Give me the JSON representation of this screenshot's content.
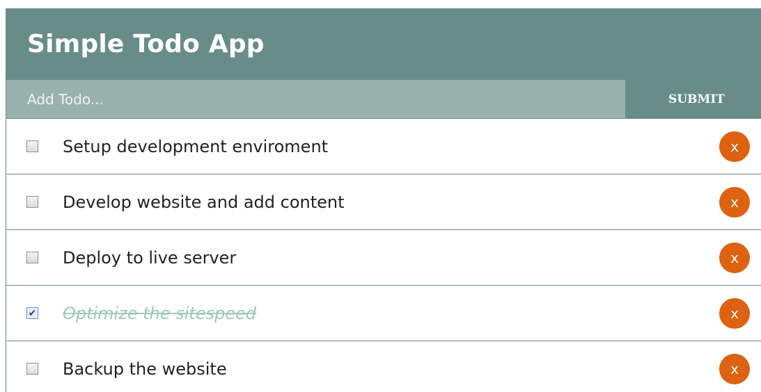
{
  "app": {
    "title": "Simple Todo App"
  },
  "form": {
    "placeholder": "Add Todo...",
    "value": "",
    "submit_label": "SUBMIT"
  },
  "todos": [
    {
      "text": "Setup development enviroment",
      "completed": false,
      "delete_label": "x"
    },
    {
      "text": "Develop website and add content",
      "completed": false,
      "delete_label": "x"
    },
    {
      "text": "Deploy to live server",
      "completed": false,
      "delete_label": "x"
    },
    {
      "text": "Optimize the sitespeed",
      "completed": true,
      "delete_label": "x"
    },
    {
      "text": "Backup the website",
      "completed": false,
      "delete_label": "x"
    }
  ],
  "colors": {
    "header": "#688d88",
    "input_bg": "#9ab2ae",
    "delete_button": "#dd6211",
    "completed_text": "#9ec9b8"
  }
}
